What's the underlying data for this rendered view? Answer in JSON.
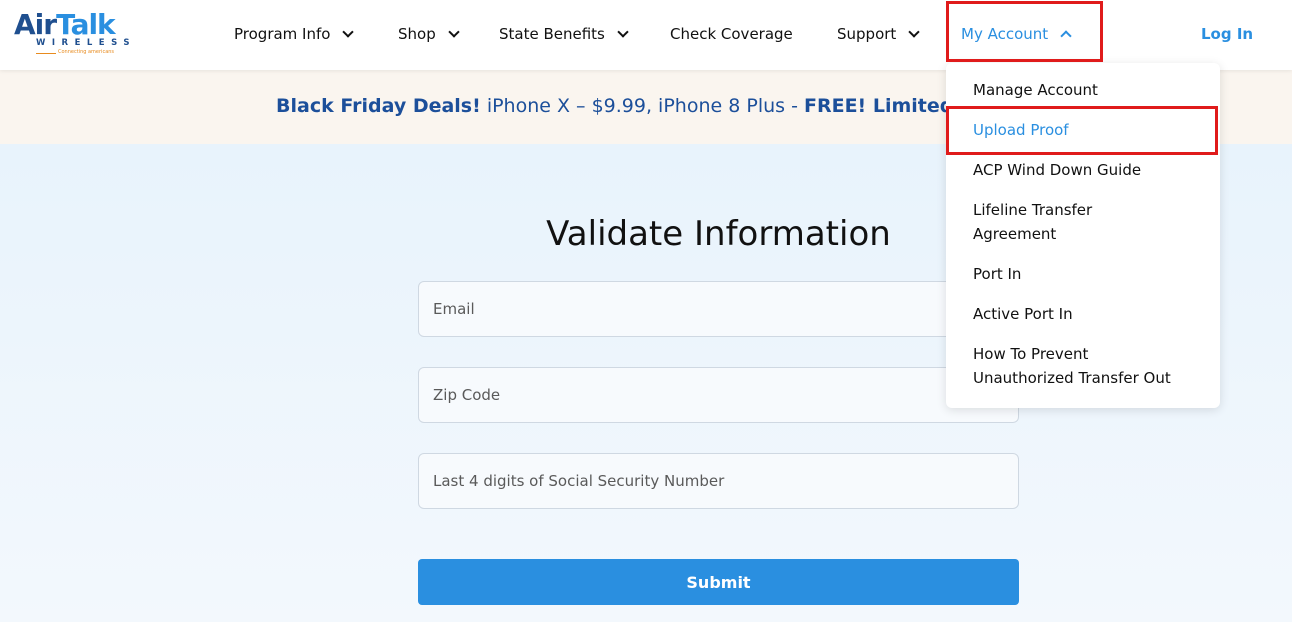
{
  "brand": {
    "logo_air": "Air",
    "logo_talk": "Talk",
    "logo_wireless": "WIRELESS",
    "logo_tagline": "Connecting americans"
  },
  "nav": {
    "items": [
      {
        "label": "Program Info",
        "has_dropdown": true
      },
      {
        "label": "Shop",
        "has_dropdown": true
      },
      {
        "label": "State Benefits",
        "has_dropdown": true
      },
      {
        "label": "Check Coverage",
        "has_dropdown": false
      },
      {
        "label": "Support",
        "has_dropdown": true
      },
      {
        "label": "My Account",
        "has_dropdown": true,
        "expanded": true
      }
    ],
    "login": "Log In"
  },
  "banner": {
    "part1_bold": "Black Friday Deals!",
    "part2": " iPhone X – $9.99, iPhone 8 Plus - ",
    "part3_bold": "FREE! Limited"
  },
  "form": {
    "title": "Validate Information",
    "email_placeholder": "Email",
    "zip_placeholder": "Zip Code",
    "ssn_placeholder": "Last 4 digits of Social Security Number",
    "submit_label": "Submit"
  },
  "account_menu": {
    "items": [
      {
        "lines": [
          "Manage Account"
        ]
      },
      {
        "lines": [
          "Upload Proof"
        ],
        "active": true
      },
      {
        "lines": [
          "ACP Wind Down Guide"
        ]
      },
      {
        "lines": [
          "Lifeline Transfer",
          "Agreement"
        ]
      },
      {
        "lines": [
          "Port In"
        ]
      },
      {
        "lines": [
          "Active Port In"
        ]
      },
      {
        "lines": [
          "How To Prevent",
          "Unauthorized Transfer Out"
        ]
      }
    ]
  },
  "colors": {
    "accent": "#2a8fe0",
    "brand_dark": "#1f4f8f",
    "highlight_box": "#e01b1b",
    "banner_bg": "#faf5ef"
  }
}
